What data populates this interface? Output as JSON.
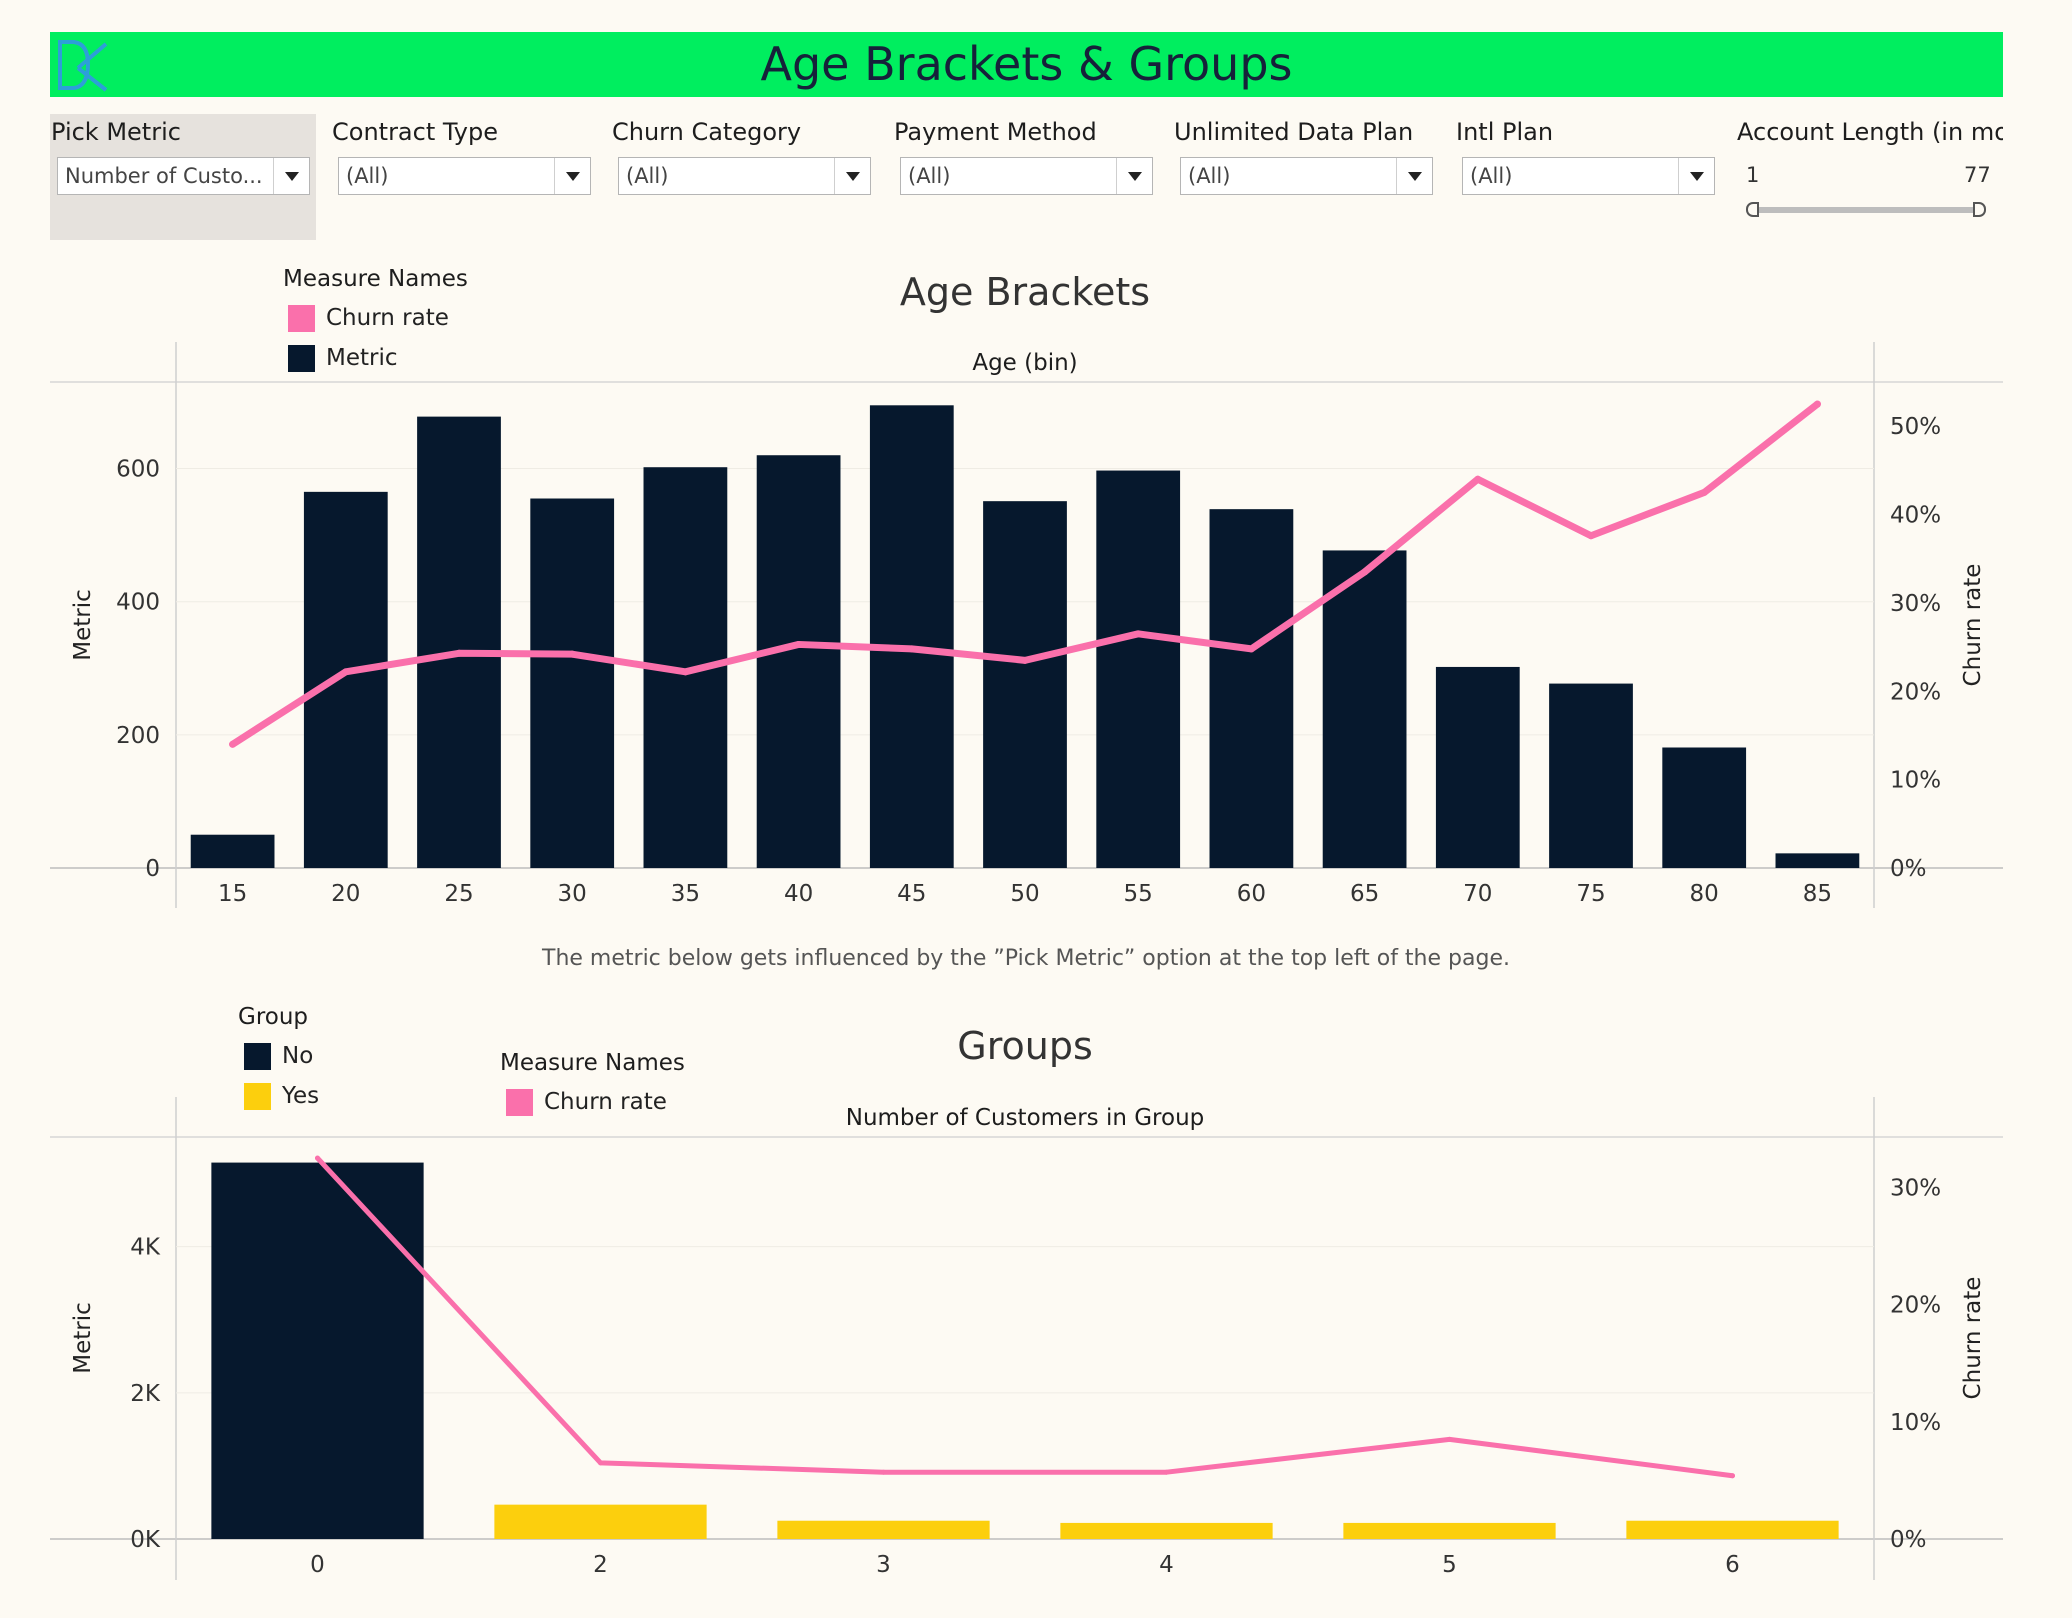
{
  "header": {
    "title": "Age Brackets & Groups",
    "logo_icon": "dk-logo-icon"
  },
  "filters": {
    "pick_metric": {
      "label": "Pick Metric",
      "value": "Number of Custo..."
    },
    "contract_type": {
      "label": "Contract Type",
      "value": "(All)"
    },
    "churn_category": {
      "label": "Churn Category",
      "value": "(All)"
    },
    "payment_method": {
      "label": "Payment Method",
      "value": "(All)"
    },
    "unlimited_data_plan": {
      "label": "Unlimited Data Plan",
      "value": "(All)"
    },
    "intl_plan": {
      "label": "Intl Plan",
      "value": "(All)"
    },
    "account_length": {
      "label": "Account Length (in mo..",
      "min": "1",
      "max": "77",
      "range": [
        0,
        1
      ]
    }
  },
  "note": "The metric below gets influenced by the ”Pick Metric” option at the top left of the page.",
  "colors": {
    "bar": "#06182d",
    "churn": "#fa70ab",
    "yes": "#fccf0d",
    "title_bar": "#00ee5f"
  },
  "chart_data": [
    {
      "type": "bar",
      "title": "Age Brackets",
      "header_label": "Age (bin)",
      "legend": {
        "title": "Measure Names",
        "items": [
          "Churn rate",
          "Metric"
        ]
      },
      "ylabel": "Metric",
      "y2label": "Churn rate",
      "categories": [
        "15",
        "20",
        "25",
        "30",
        "35",
        "40",
        "45",
        "50",
        "55",
        "60",
        "65",
        "70",
        "75",
        "80",
        "85"
      ],
      "ylim": [
        0,
        730
      ],
      "y2lim": [
        0,
        0.55
      ],
      "yticks": [
        0,
        200,
        400,
        600
      ],
      "ytick_labels": [
        "0",
        "200",
        "400",
        "600"
      ],
      "y2ticks": [
        0,
        0.1,
        0.2,
        0.3,
        0.4,
        0.5
      ],
      "y2tick_labels": [
        "0%",
        "10%",
        "20%",
        "30%",
        "40%",
        "50%"
      ],
      "series": [
        {
          "name": "Metric",
          "type": "bar",
          "axis": "left",
          "values": [
            50,
            565,
            678,
            555,
            602,
            620,
            695,
            551,
            597,
            539,
            477,
            302,
            277,
            181,
            22
          ]
        },
        {
          "name": "Churn rate",
          "type": "line",
          "axis": "right",
          "values": [
            0.14,
            0.222,
            0.243,
            0.242,
            0.222,
            0.253,
            0.248,
            0.235,
            0.265,
            0.248,
            0.335,
            0.44,
            0.376,
            0.425,
            0.525
          ]
        }
      ]
    },
    {
      "type": "bar",
      "title": "Groups",
      "header_label": "Number of Customers in Group",
      "legend_group": {
        "title": "Group",
        "items": [
          "No",
          "Yes"
        ]
      },
      "legend": {
        "title": "Measure Names",
        "items": [
          "Churn rate"
        ]
      },
      "ylabel": "Metric",
      "y2label": "Churn rate",
      "categories": [
        "0",
        "2",
        "3",
        "4",
        "5",
        "6"
      ],
      "ylim": [
        0,
        5500
      ],
      "y2lim": [
        0,
        0.343
      ],
      "yticks": [
        0,
        2000,
        4000
      ],
      "ytick_labels": [
        "0K",
        "2K",
        "4K"
      ],
      "y2ticks": [
        0,
        0.1,
        0.2,
        0.3
      ],
      "y2tick_labels": [
        "0%",
        "10%",
        "20%",
        "30%"
      ],
      "series": [
        {
          "name": "Metric",
          "type": "bar",
          "axis": "left",
          "group": [
            "No",
            "Yes",
            "Yes",
            "Yes",
            "Yes",
            "Yes"
          ],
          "values": [
            5150,
            470,
            250,
            220,
            220,
            250
          ]
        },
        {
          "name": "Churn rate",
          "type": "line",
          "axis": "right",
          "values": [
            0.325,
            0.065,
            0.057,
            0.057,
            0.085,
            0.054
          ]
        }
      ]
    }
  ]
}
